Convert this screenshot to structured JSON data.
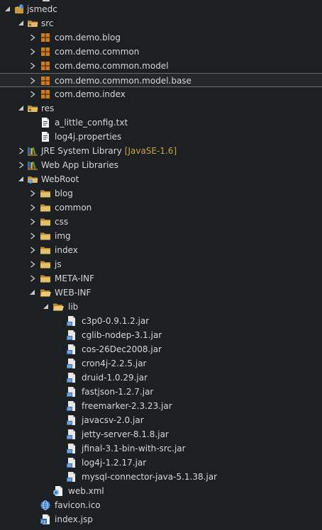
{
  "explorer": {
    "nodes": [
      {
        "id": "jsmedc",
        "label": "jsmedc",
        "icon": "project-icon",
        "arrow": "expanded"
      },
      {
        "id": "src",
        "label": "src",
        "icon": "source-folder-icon",
        "arrow": "expanded"
      },
      {
        "id": "pkg-blog",
        "label": "com.demo.blog",
        "icon": "package-icon",
        "arrow": "collapsed"
      },
      {
        "id": "pkg-common",
        "label": "com.demo.common",
        "icon": "package-icon",
        "arrow": "collapsed"
      },
      {
        "id": "pkg-common-model",
        "label": "com.demo.common.model",
        "icon": "package-icon",
        "arrow": "collapsed"
      },
      {
        "id": "pkg-common-model-base",
        "label": "com.demo.common.model.base",
        "icon": "package-icon",
        "arrow": "collapsed",
        "selected": true
      },
      {
        "id": "pkg-index",
        "label": "com.demo.index",
        "icon": "package-icon",
        "arrow": "collapsed"
      },
      {
        "id": "res",
        "label": "res",
        "icon": "source-folder-icon",
        "arrow": "expanded"
      },
      {
        "id": "config-txt",
        "label": "a_little_config.txt",
        "icon": "text-file-icon",
        "arrow": "none"
      },
      {
        "id": "log4j-properties",
        "label": "log4j.properties",
        "icon": "text-file-icon",
        "arrow": "none"
      },
      {
        "id": "jre-library",
        "label": "JRE System Library",
        "decoration": "[JavaSE-1.6]",
        "icon": "library-icon",
        "arrow": "collapsed"
      },
      {
        "id": "webapp-libraries",
        "label": "Web App Libraries",
        "icon": "library-icon",
        "arrow": "collapsed"
      },
      {
        "id": "webroot",
        "label": "WebRoot",
        "icon": "web-folder-icon",
        "arrow": "expanded"
      },
      {
        "id": "blog",
        "label": "blog",
        "icon": "folder-icon",
        "arrow": "collapsed"
      },
      {
        "id": "common",
        "label": "common",
        "icon": "folder-icon",
        "arrow": "collapsed"
      },
      {
        "id": "css",
        "label": "css",
        "icon": "folder-icon",
        "arrow": "collapsed"
      },
      {
        "id": "img",
        "label": "img",
        "icon": "folder-icon",
        "arrow": "collapsed"
      },
      {
        "id": "index",
        "label": "index",
        "icon": "folder-icon",
        "arrow": "collapsed"
      },
      {
        "id": "js",
        "label": "js",
        "icon": "folder-icon",
        "arrow": "collapsed"
      },
      {
        "id": "meta-inf",
        "label": "META-INF",
        "icon": "folder-icon",
        "arrow": "collapsed"
      },
      {
        "id": "web-inf",
        "label": "WEB-INF",
        "icon": "folder-open-icon",
        "arrow": "expanded"
      },
      {
        "id": "lib",
        "label": "lib",
        "icon": "folder-open-icon",
        "arrow": "expanded"
      },
      {
        "id": "jar-c3p0",
        "label": "c3p0-0.9.1.2.jar",
        "icon": "jar-icon",
        "arrow": "none"
      },
      {
        "id": "jar-cglib",
        "label": "cglib-nodep-3.1.jar",
        "icon": "jar-icon",
        "arrow": "none"
      },
      {
        "id": "jar-cos",
        "label": "cos-26Dec2008.jar",
        "icon": "jar-icon",
        "arrow": "none"
      },
      {
        "id": "jar-cron4j",
        "label": "cron4j-2.2.5.jar",
        "icon": "jar-icon",
        "arrow": "none"
      },
      {
        "id": "jar-druid",
        "label": "druid-1.0.29.jar",
        "icon": "jar-icon",
        "arrow": "none"
      },
      {
        "id": "jar-fastjson",
        "label": "fastjson-1.2.7.jar",
        "icon": "jar-icon",
        "arrow": "none"
      },
      {
        "id": "jar-freemarker",
        "label": "freemarker-2.3.23.jar",
        "icon": "jar-icon",
        "arrow": "none"
      },
      {
        "id": "jar-javacsv",
        "label": "javacsv-2.0.jar",
        "icon": "jar-icon",
        "arrow": "none"
      },
      {
        "id": "jar-jetty",
        "label": "jetty-server-8.1.8.jar",
        "icon": "jar-icon",
        "arrow": "none"
      },
      {
        "id": "jar-jfinal",
        "label": "jfinal-3.1-bin-with-src.jar",
        "icon": "jar-icon",
        "arrow": "none"
      },
      {
        "id": "jar-log4j",
        "label": "log4j-1.2.17.jar",
        "icon": "jar-icon",
        "arrow": "none"
      },
      {
        "id": "jar-mysql",
        "label": "mysql-connector-java-5.1.38.jar",
        "icon": "jar-icon",
        "arrow": "none"
      },
      {
        "id": "web-xml",
        "label": "web.xml",
        "icon": "xml-file-icon",
        "arrow": "none"
      },
      {
        "id": "favicon",
        "label": "favicon.ico",
        "icon": "globe-icon",
        "arrow": "none"
      },
      {
        "id": "index-jsp",
        "label": "index.jsp",
        "icon": "jsp-file-icon",
        "arrow": "none"
      }
    ]
  }
}
